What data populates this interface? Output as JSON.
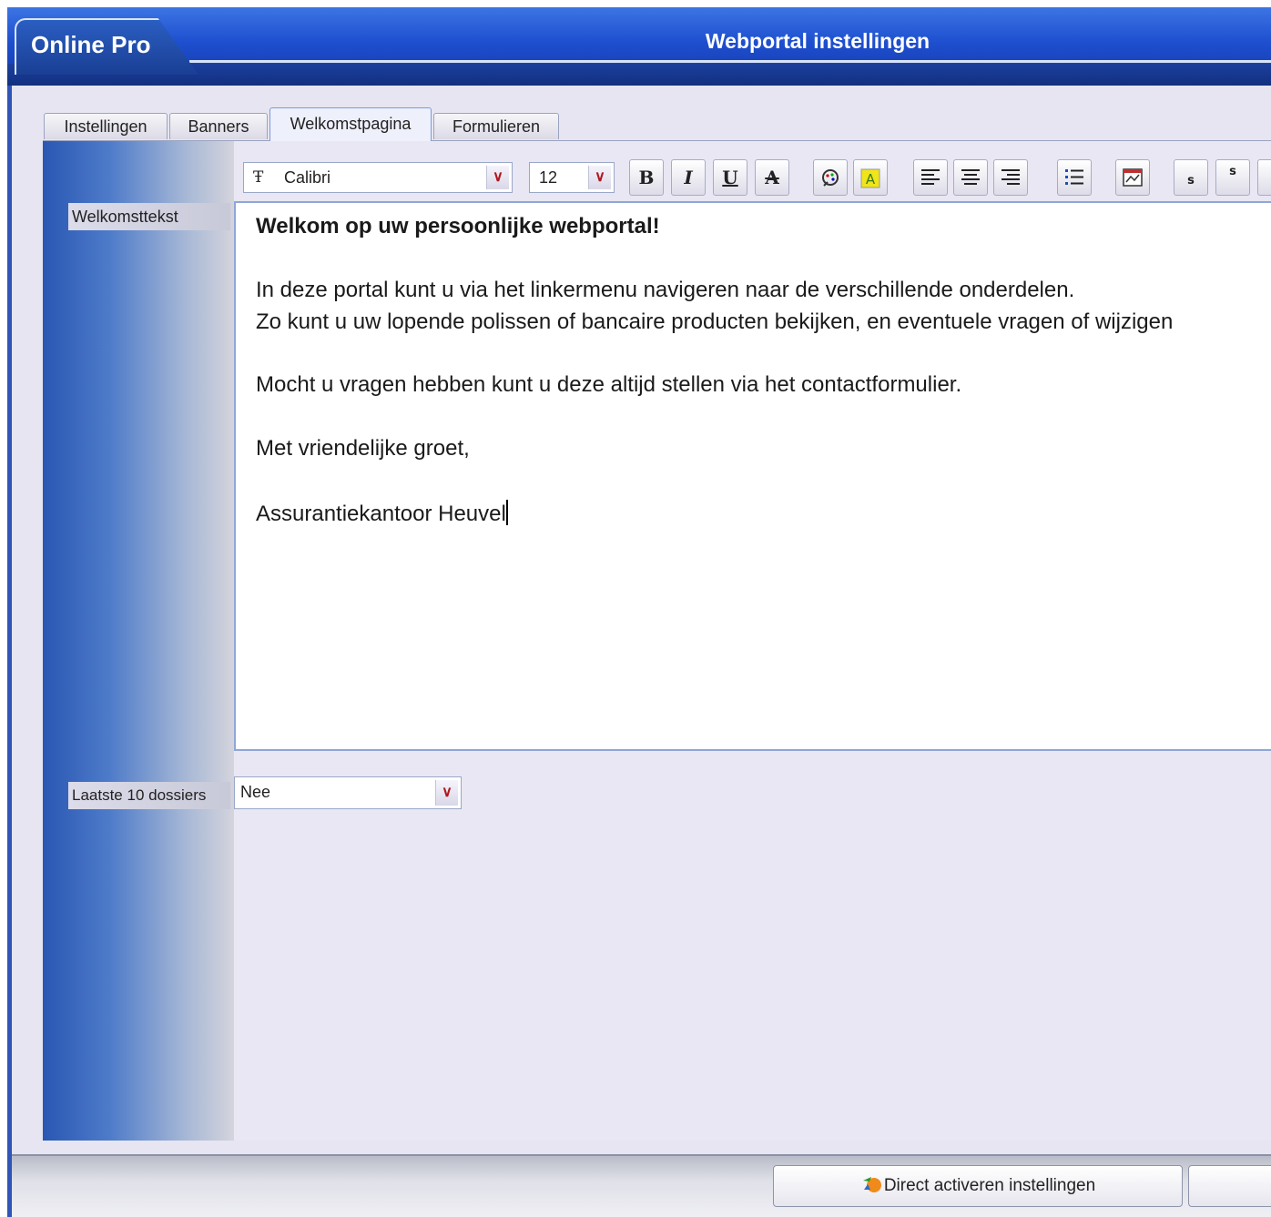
{
  "window": {
    "app_name": "Online Pro",
    "title": "Webportal instellingen"
  },
  "tabs": [
    {
      "label": "Instellingen",
      "active": false
    },
    {
      "label": "Banners",
      "active": false
    },
    {
      "label": "Welkomstpagina",
      "active": true
    },
    {
      "label": "Formulieren",
      "active": false
    }
  ],
  "fields": {
    "welcome_label": "Welkomsttekst",
    "last_files_label": "Laatste 10 dossiers",
    "last_files_value": "Nee"
  },
  "toolbar": {
    "font_name": "Calibri",
    "font_size": "12",
    "bold": "B",
    "italic": "I",
    "underline": "U",
    "strike": "A",
    "subscript": "s",
    "superscript": "s"
  },
  "editor": {
    "heading": "Welkom op uw persoonlijke webportal!",
    "line1": "In deze portal kunt u via het linkermenu navigeren naar de verschillende onderdelen.",
    "line2": "Zo kunt u uw lopende polissen of bancaire producten bekijken, en eventuele vragen of wijzigen",
    "line3": "Mocht u vragen hebben kunt u deze altijd stellen via het contactformulier.",
    "line4": "Met vriendelijke groet,",
    "line5": "Assurantiekantoor Heuvel"
  },
  "footer": {
    "activate_label": "Direct activeren instellingen"
  },
  "colors": {
    "titlebar": "#1e4fcf",
    "content_bg": "#e7e5f1",
    "dropdown_arrow": "#b0161e"
  }
}
